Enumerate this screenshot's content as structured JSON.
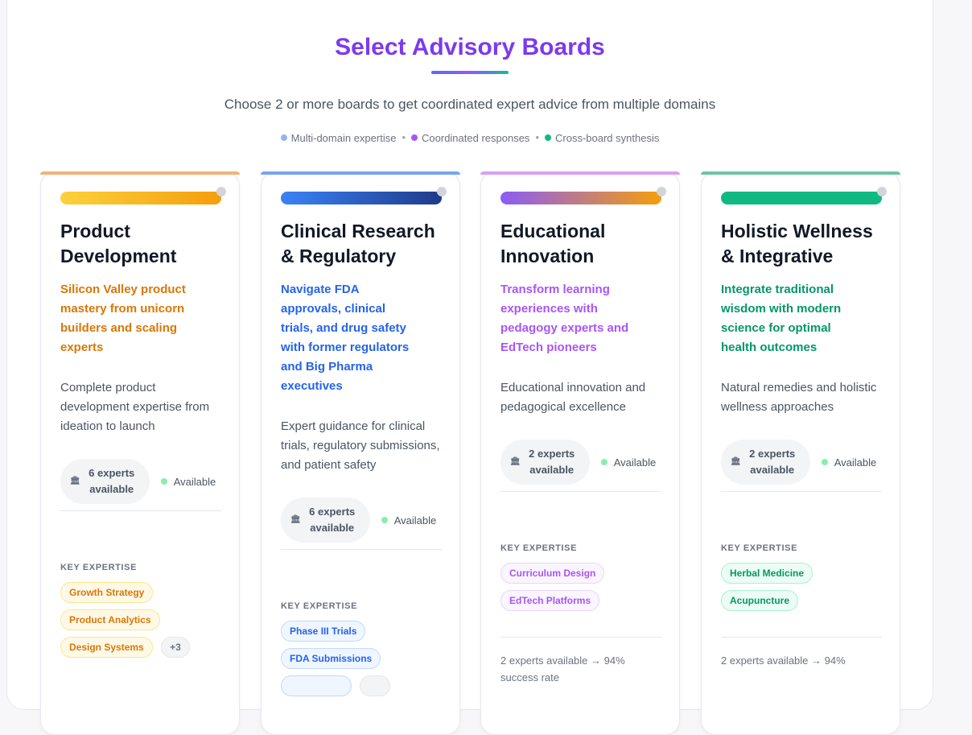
{
  "header": {
    "title": "Select Advisory Boards",
    "subtitle": "Choose 2 or more boards to get coordinated expert advice from multiple domains",
    "features": [
      {
        "label": "Multi-domain expertise",
        "color": "#93b4f0"
      },
      {
        "label": "Coordinated responses",
        "color": "#a855f7"
      },
      {
        "label": "Cross-board synthesis",
        "color": "#10b981"
      }
    ]
  },
  "cards": [
    {
      "title": "Product Development",
      "tagline": "Silicon Valley product mastery from unicorn builders and scaling experts",
      "description": "Complete product development expertise from ideation to launch",
      "experts": "6 experts available",
      "status": "Available",
      "key_label": "KEY EXPERTISE",
      "chips": [
        "Growth Strategy",
        "Product Analytics",
        "Design Systems"
      ],
      "more": "+3",
      "footer": "",
      "colors": {
        "accent": "#d97706",
        "top": "#f0b27a",
        "bar_from": "#fbd13c",
        "bar_to": "#f59e0b",
        "chip_bg": "#fef9e7",
        "chip_border": "#fde68a"
      }
    },
    {
      "title": "Clinical Research & Regulatory",
      "tagline": "Navigate FDA approvals, clinical trials, and drug safety with former regulators and Big Pharma executives",
      "description": "Expert guidance for clinical trials, regulatory submissions, and patient safety",
      "experts": "6 experts available",
      "status": "Available",
      "key_label": "KEY EXPERTISE",
      "chips": [
        "Phase III Trials",
        "FDA Submissions"
      ],
      "more": "",
      "footer": "",
      "colors": {
        "accent": "#2563eb",
        "top": "#7aa3f0",
        "bar_from": "#3b82f6",
        "bar_to": "#1e3a8a",
        "chip_bg": "#eff6ff",
        "chip_border": "#bfdbfe"
      }
    },
    {
      "title": "Educational Innovation",
      "tagline": "Transform learning experiences with pedagogy experts and EdTech pioneers",
      "description": "Educational innovation and pedagogical excellence",
      "experts": "2 experts available",
      "status": "Available",
      "key_label": "KEY EXPERTISE",
      "chips": [
        "Curriculum Design",
        "EdTech Platforms"
      ],
      "more": "",
      "footer": "2 experts available → 94% success rate",
      "colors": {
        "accent": "#a855f7",
        "top": "#d8a0f0",
        "bar_from": "#8b5cf6",
        "bar_to": "#f59e0b",
        "chip_bg": "#faf5ff",
        "chip_border": "#e9d5ff"
      }
    },
    {
      "title": "Holistic Wellness & Integrative",
      "tagline": "Integrate traditional wisdom with modern science for optimal health outcomes",
      "description": "Natural remedies and holistic wellness approaches",
      "experts": "2 experts available",
      "status": "Available",
      "key_label": "KEY EXPERTISE",
      "chips": [
        "Herbal Medicine",
        "Acupuncture"
      ],
      "more": "",
      "footer": "2 experts available → 94%",
      "colors": {
        "accent": "#059669",
        "top": "#6fc4a0",
        "bar_from": "#10b981",
        "bar_to": "#10b981",
        "chip_bg": "#ecfdf5",
        "chip_border": "#a7f3d0"
      }
    }
  ]
}
